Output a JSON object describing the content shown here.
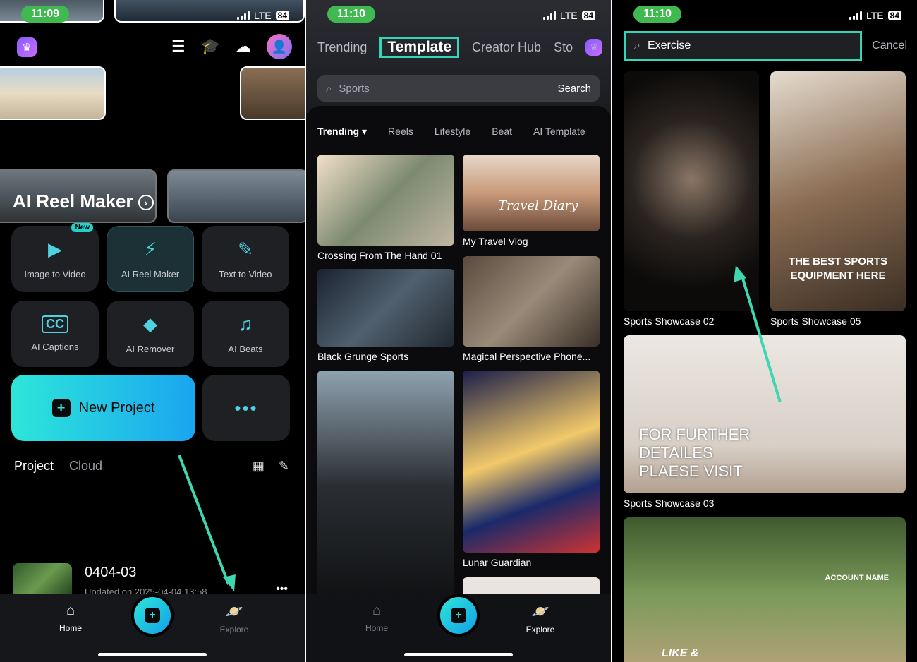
{
  "panel1": {
    "time": "11:09",
    "network": "LTE",
    "battery": "84",
    "reel_title": "AI Reel Maker",
    "tools": [
      {
        "label": "Image to Video",
        "icon": "image-to-video-icon",
        "badge": "New"
      },
      {
        "label": "AI Reel Maker",
        "icon": "reel-maker-icon"
      },
      {
        "label": "Text to Video",
        "icon": "text-to-video-icon"
      },
      {
        "label": "AI Captions",
        "icon": "captions-icon"
      },
      {
        "label": "AI Remover",
        "icon": "eraser-icon"
      },
      {
        "label": "AI Beats",
        "icon": "beats-icon"
      }
    ],
    "new_project": "New Project",
    "more": "•••",
    "tabs": [
      "Project",
      "Cloud"
    ],
    "project": {
      "name": "0404-03",
      "updated": "Updated on 2025-04-04 13:58"
    },
    "bottom_tabs": {
      "home": "Home",
      "explore": "Explore"
    }
  },
  "panel2": {
    "time": "11:10",
    "network": "LTE",
    "battery": "84",
    "nav_tabs": [
      "Trending",
      "Template",
      "Creator Hub",
      "Sto"
    ],
    "search_placeholder": "Sports",
    "search_button": "Search",
    "categories": [
      "Trending",
      "Reels",
      "Lifestyle",
      "Beat",
      "AI Template"
    ],
    "cards": [
      {
        "caption": "Crossing From The Hand 01"
      },
      {
        "caption": "My Travel Vlog",
        "overlay": "Travel Diary"
      },
      {
        "caption": "Black Grunge Sports"
      },
      {
        "caption": "Magical Perspective Phone..."
      },
      {
        "caption": ""
      },
      {
        "caption": "Lunar Guardian"
      }
    ],
    "bottom_tabs": {
      "home": "Home",
      "explore": "Explore"
    }
  },
  "panel3": {
    "time": "11:10",
    "network": "LTE",
    "battery": "84",
    "search_value": "Exercise",
    "cancel": "Cancel",
    "results": [
      {
        "caption": "Sports Showcase 02"
      },
      {
        "caption": "Sports Showcase 05",
        "overlay": "THE BEST SPORTS EQUIPMENT HERE"
      },
      {
        "caption": "Sports Showcase 03",
        "overlay": "FOR FURTHER DETAILES PLAESE VISIT"
      },
      {
        "caption": "",
        "overlay": "ACCOUNT NAME",
        "overlay2": "LIKE &"
      }
    ]
  },
  "colors": {
    "accent": "#35d6b7",
    "status_green": "#3fb950",
    "gradient_start": "#2de6d9",
    "gradient_end": "#1aa5f0"
  }
}
